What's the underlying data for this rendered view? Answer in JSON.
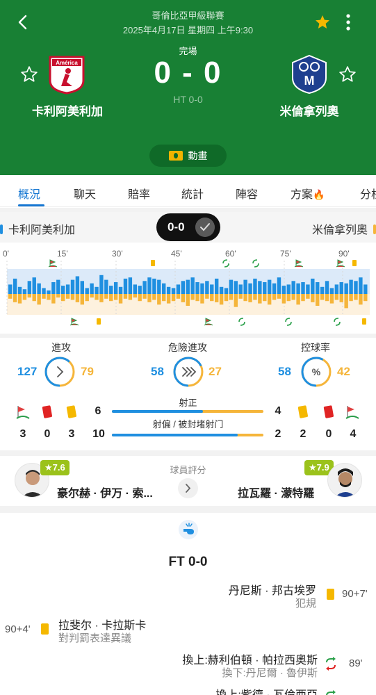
{
  "header": {
    "league": "哥倫比亞甲級聯賽",
    "datetime": "2025年4月17日 星期四 上午9:30",
    "status": "完場",
    "score": "0 - 0",
    "ht": "HT 0-0",
    "animation_label": "動畫",
    "home_name": "卡利阿美利加",
    "away_name": "米倫拿列奧",
    "home_logo_text": "América",
    "away_logo_text": "M",
    "colors": {
      "header_bg": "#188034",
      "accent_blue": "#1f8fe0",
      "accent_orange": "#f5b53a"
    }
  },
  "tabs": [
    "概況",
    "聊天",
    "賠率",
    "統計",
    "陣容",
    "方案",
    "分析"
  ],
  "teamrow": {
    "home": "卡利阿美利加",
    "away": "米倫拿列奧",
    "score": "0-0"
  },
  "timeline": {
    "ticks": [
      "0'",
      "15'",
      "30'",
      "45'",
      "60'",
      "75'",
      "90'"
    ],
    "home_pressure": [
      40,
      65,
      30,
      20,
      55,
      70,
      45,
      25,
      15,
      50,
      60,
      35,
      40,
      60,
      75,
      55,
      25,
      45,
      30,
      80,
      60,
      35,
      50,
      30,
      65,
      70,
      40,
      35,
      55,
      70,
      65,
      60,
      45,
      30,
      25,
      40,
      55,
      60,
      70,
      50,
      45,
      55,
      40,
      65,
      30,
      25,
      60,
      55,
      40,
      60,
      45,
      65,
      55,
      50,
      60,
      45,
      70,
      35,
      40,
      55,
      45,
      50,
      40,
      65,
      50,
      30,
      55,
      25,
      40,
      50,
      45,
      60,
      55,
      70,
      40
    ],
    "away_pressure": [
      20,
      35,
      40,
      25,
      15,
      30,
      45,
      20,
      25,
      40,
      15,
      30,
      20,
      25,
      35,
      45,
      30,
      15,
      25,
      35,
      20,
      30,
      25,
      40,
      20,
      25,
      15,
      30,
      20,
      35,
      25,
      45,
      30,
      40,
      30,
      20,
      35,
      50,
      25,
      30,
      40,
      20,
      30,
      35,
      45,
      30,
      25,
      55,
      20,
      30,
      35,
      25,
      40,
      30,
      45,
      25,
      20,
      40,
      30,
      25,
      45,
      30,
      20,
      35,
      50,
      25,
      30,
      40,
      25,
      35,
      60,
      30,
      25,
      45,
      30
    ]
  },
  "stats": {
    "attack": {
      "label": "進攻",
      "home": "127",
      "away": "79",
      "home_share": 0.62
    },
    "dangerous": {
      "label": "危險進攻",
      "home": "58",
      "away": "27",
      "home_share": 0.68
    },
    "possession": {
      "label": "控球率",
      "home": "58",
      "away": "42",
      "home_share": 0.58
    },
    "on_target": {
      "label": "射正",
      "home": "6",
      "away": "4",
      "home_share": 0.6
    },
    "off_target": {
      "label": "射偏 / 被封堵射门",
      "home": "10",
      "away": "2",
      "home_share": 0.83
    },
    "home_cards": {
      "corners": "3",
      "red": "0",
      "yellow": "3"
    },
    "away_cards": {
      "yellow": "2",
      "red": "0",
      "corners": "4"
    }
  },
  "player_rating": {
    "title": "球員評分",
    "home": {
      "rating": "★7.6",
      "name": "豪尔赫 · 伊万 · 索..."
    },
    "away": {
      "rating": "★7.9",
      "name": "拉瓦羅 · 濛特羅"
    }
  },
  "events": {
    "ft": "FT 0-0",
    "items": [
      {
        "side": "away",
        "main": "丹尼斯 · 邦古埃罗",
        "sub": "犯規",
        "time": "90+7'",
        "type": "yellow"
      },
      {
        "side": "home",
        "main": "拉斐尔 · 卡拉斯卡",
        "sub": "對判罰表達異議",
        "time": "90+4'",
        "type": "yellow"
      },
      {
        "side": "away",
        "main": "換上:赫利伯頓 · 帕拉西奧斯",
        "sub": "換下:丹尼爾 · 魯伊斯",
        "time": "89'",
        "type": "sub"
      },
      {
        "side": "away",
        "main": "換上:紫德 · 瓦倫西亞",
        "sub": "",
        "time": "",
        "type": "sub"
      }
    ]
  }
}
